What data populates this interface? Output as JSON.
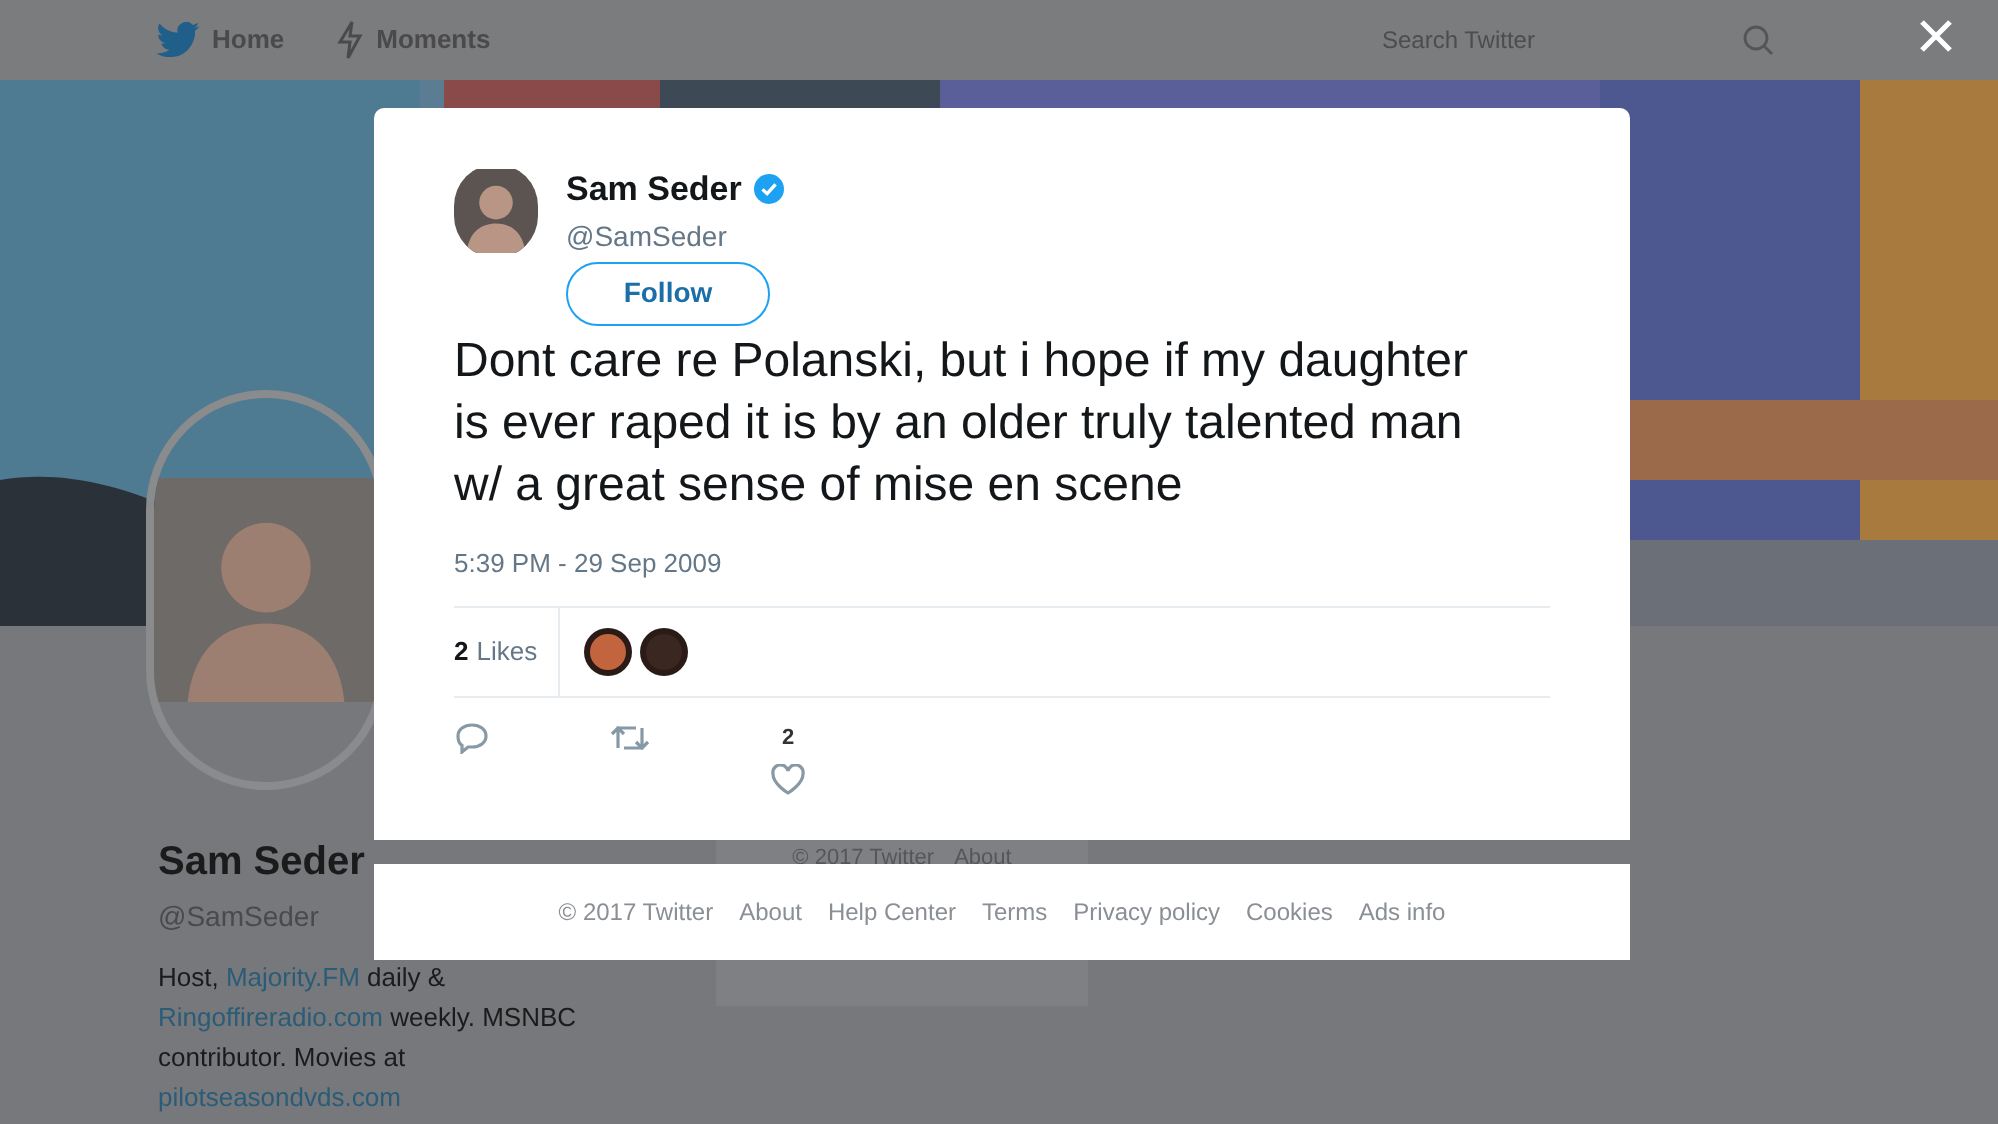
{
  "nav": {
    "items": [
      {
        "label": "Home"
      },
      {
        "label": "Moments"
      }
    ],
    "search": {
      "placeholder": "Search Twitter"
    }
  },
  "profile": {
    "name": "Sam Seder",
    "handle": "@SamSeder",
    "bio": [
      {
        "kind": "text",
        "text": "Host, "
      },
      {
        "kind": "link",
        "text": "Majority.FM"
      },
      {
        "kind": "text",
        "text": " daily & "
      },
      {
        "kind": "link",
        "text": "Ringoffireradio.com"
      },
      {
        "kind": "text",
        "text": " weekly. MSNBC contributor. Movies at "
      },
      {
        "kind": "link",
        "text": "pilotseasondvds.com"
      }
    ]
  },
  "background_footer": [
    "© 2017 Twitter",
    "About"
  ],
  "tweet": {
    "author": {
      "name": "Sam Seder",
      "handle": "@SamSeder",
      "verified": true
    },
    "follow_label": "Follow",
    "text": "Dont care re Polanski, but i hope if my daughter is ever raped it is by an older truly talented man w/ a great sense of mise en scene",
    "timestamp": "5:39 PM - 29 Sep 2009",
    "likes": {
      "count": "2",
      "label": "Likes"
    },
    "likers": [
      {
        "color": "#c2653e"
      },
      {
        "color": "#3b2721"
      }
    ],
    "actions": [
      {
        "kind": "reply"
      },
      {
        "kind": "retweet"
      },
      {
        "kind": "like",
        "count": "2"
      }
    ]
  },
  "footer": [
    "© 2017 Twitter",
    "About",
    "Help Center",
    "Terms",
    "Privacy policy",
    "Cookies",
    "Ads info"
  ]
}
